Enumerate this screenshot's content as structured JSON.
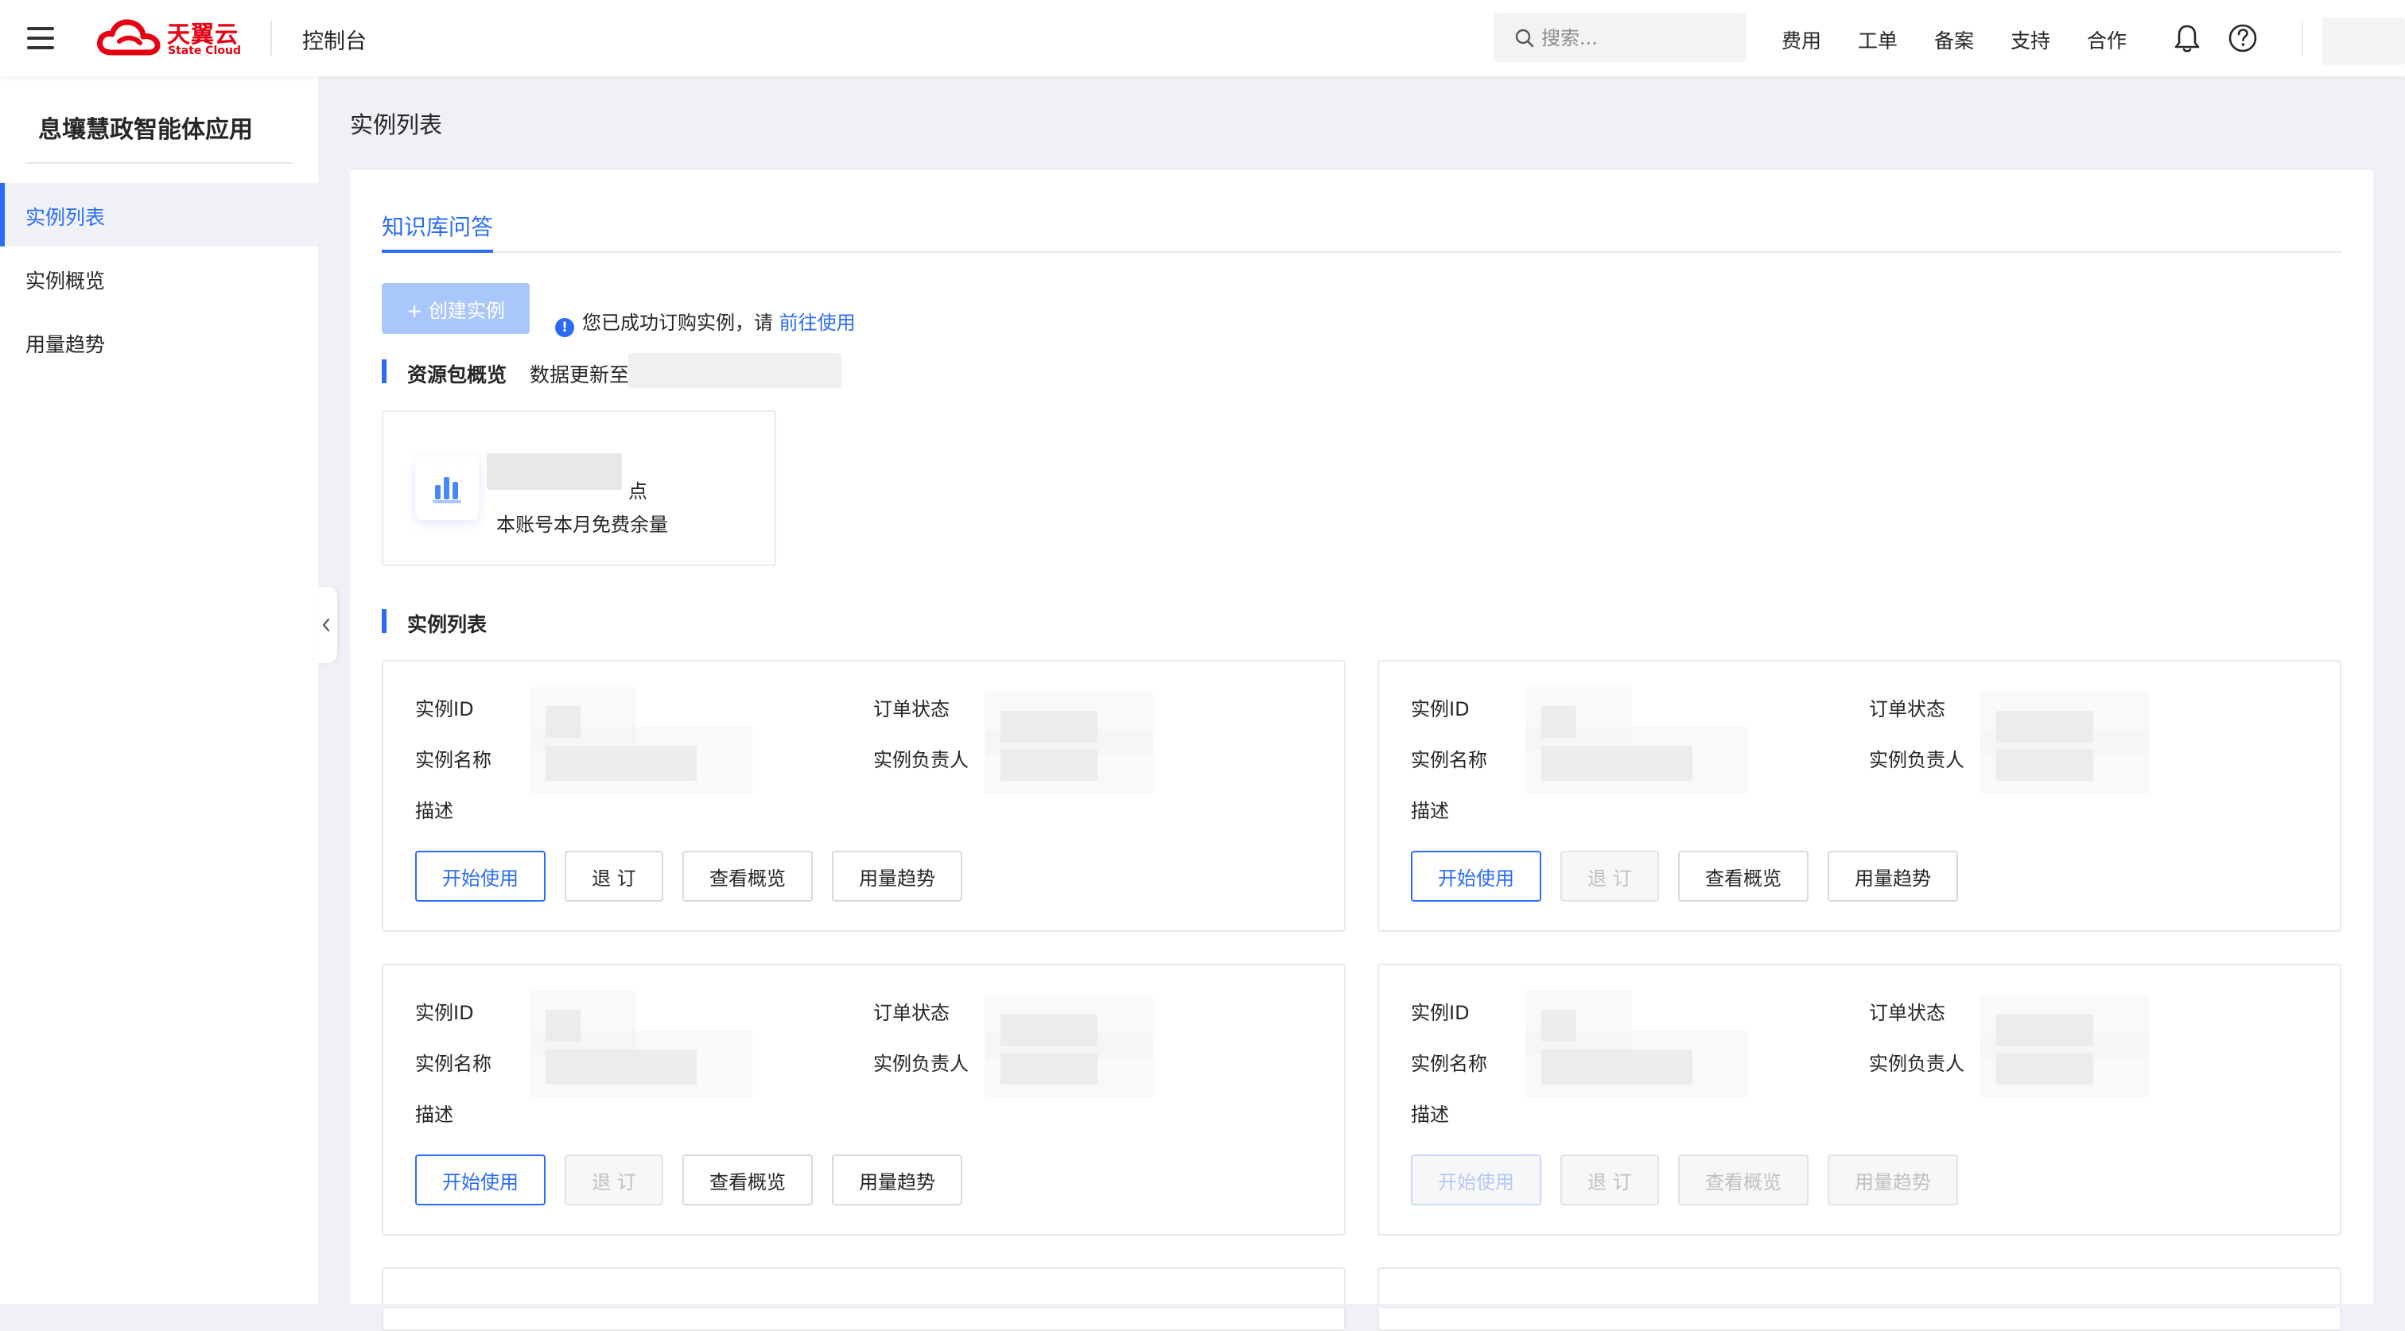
{
  "topbar": {
    "brand_cn": "天翼云",
    "brand_en": "State Cloud",
    "console_title": "控制台",
    "search_placeholder": "搜索...",
    "nav": [
      "费用",
      "工单",
      "备案",
      "支持",
      "合作"
    ],
    "icons": {
      "menu": "menu-icon",
      "search": "search-icon",
      "bell": "bell-icon",
      "help": "help-icon"
    }
  },
  "sidebar": {
    "title": "息壤慧政智能体应用",
    "items": [
      {
        "label": "实例列表",
        "active": true
      },
      {
        "label": "实例概览",
        "active": false
      },
      {
        "label": "用量趋势",
        "active": false
      }
    ]
  },
  "main": {
    "page_title": "实例列表",
    "tab": "知识库问答",
    "create_button": "+ 创建实例",
    "notice_text": "您已成功订购实例，请",
    "notice_link": "前往使用",
    "resource_section": {
      "title": "资源包概览",
      "update_label": "数据更新至",
      "unit": "点",
      "card_label": "本账号本月免费余量"
    },
    "instance_section": {
      "title": "实例列表",
      "field_labels": {
        "id": "实例ID",
        "status": "订单状态",
        "name": "实例名称",
        "owner": "实例负责人",
        "desc": "描述"
      },
      "button_labels": {
        "start": "开始使用",
        "unsubscribe": "退 订",
        "overview": "查看概览",
        "trend": "用量趋势"
      },
      "cards": [
        {
          "start_enabled": true,
          "unsubscribe_enabled": true,
          "overview_enabled": true,
          "trend_enabled": true
        },
        {
          "start_enabled": true,
          "unsubscribe_enabled": false,
          "overview_enabled": true,
          "trend_enabled": true
        },
        {
          "start_enabled": true,
          "unsubscribe_enabled": false,
          "overview_enabled": true,
          "trend_enabled": true
        },
        {
          "start_enabled": false,
          "unsubscribe_enabled": false,
          "overview_enabled": false,
          "trend_enabled": false
        }
      ]
    }
  },
  "colors": {
    "accent": "#2a6cf6",
    "brand_red": "#e60012",
    "page_bg": "#f0f1f5"
  }
}
